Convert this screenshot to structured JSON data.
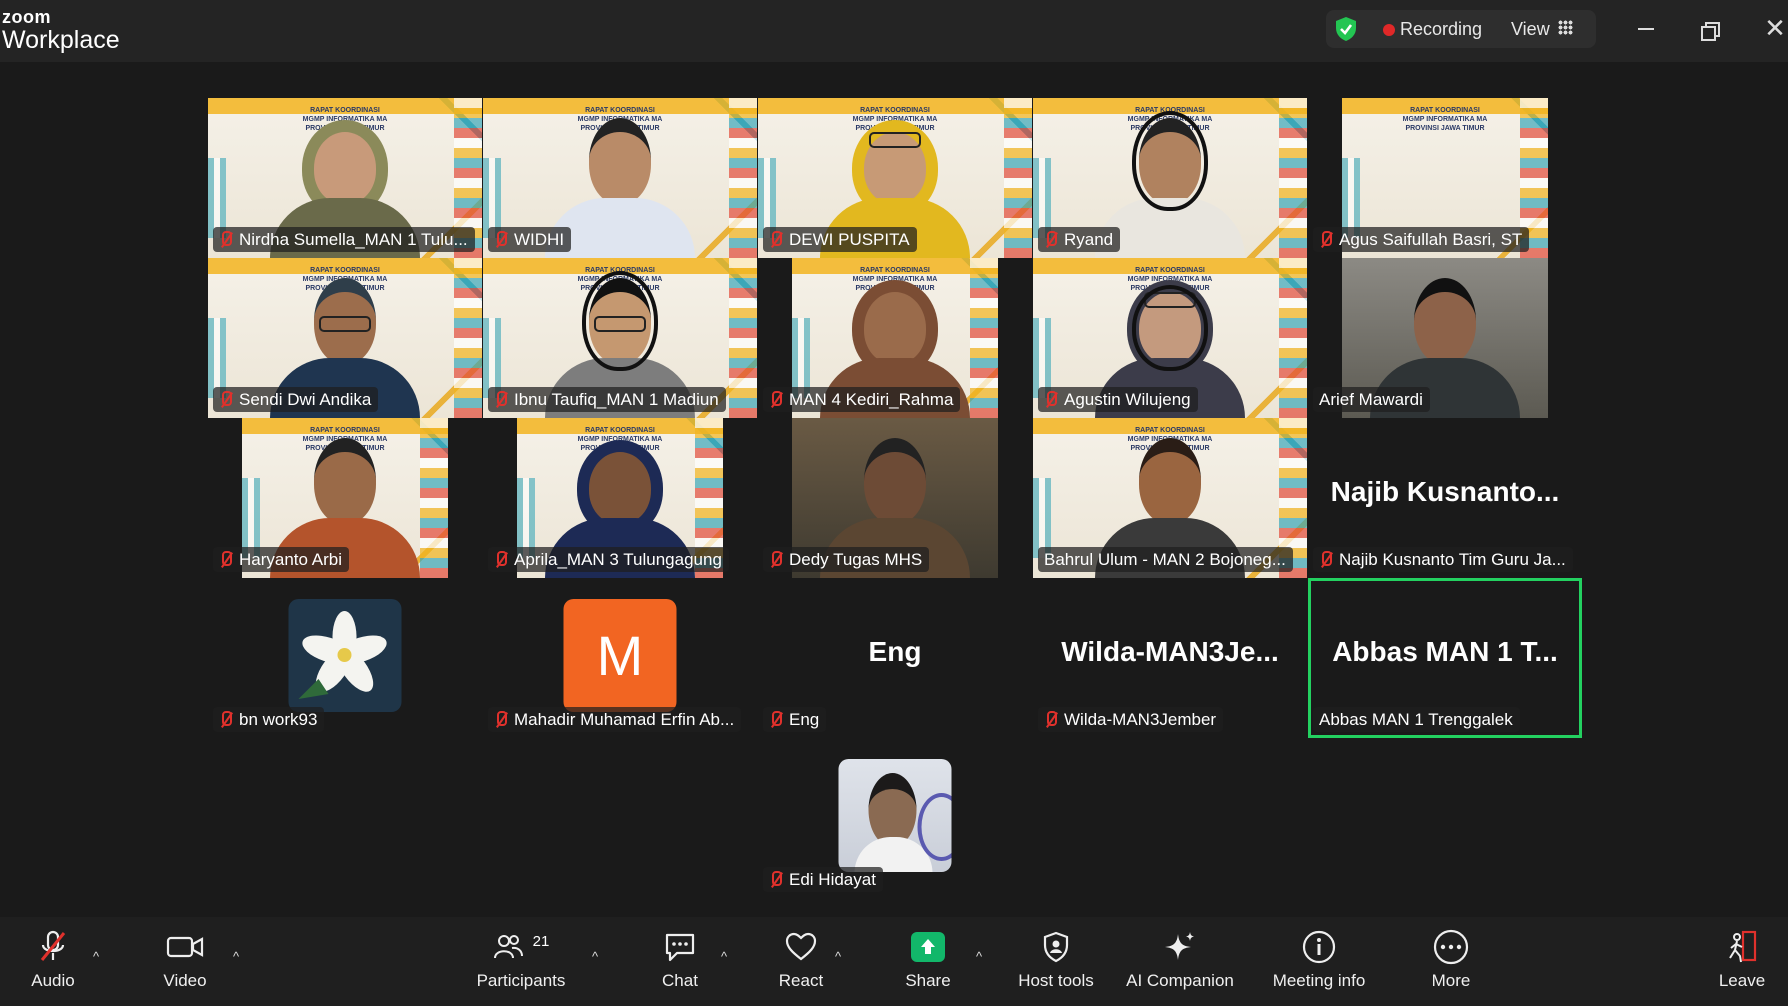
{
  "titlebar": {
    "brand_small": "zoom",
    "brand_large": "Workplace",
    "recording_label": "Recording",
    "view_label": "View"
  },
  "participants": [
    {
      "name": "Nirdha Sumella_MAN 1 Tulu...",
      "muted": true
    },
    {
      "name": "WIDHI",
      "muted": true
    },
    {
      "name": "DEWI PUSPITA",
      "muted": true
    },
    {
      "name": "Ryand",
      "muted": true
    },
    {
      "name": "Agus Saifullah Basri, ST",
      "muted": true
    },
    {
      "name": "Sendi Dwi Andika",
      "muted": true
    },
    {
      "name": "Ibnu Taufiq_MAN 1 Madiun",
      "muted": true
    },
    {
      "name": "MAN 4 Kediri_Rahma",
      "muted": true
    },
    {
      "name": "Agustin Wilujeng",
      "muted": true
    },
    {
      "name": "Arief Mawardi",
      "muted": false
    },
    {
      "name": "Haryanto Arbi",
      "muted": true
    },
    {
      "name": "Aprila_MAN 3 Tulungagung",
      "muted": true
    },
    {
      "name": "Dedy Tugas MHS",
      "muted": true
    },
    {
      "name": "Bahrul Ulum - MAN 2 Bojoneg...",
      "muted": false
    },
    {
      "name": "Najib Kusnanto Tim Guru Ja...",
      "muted": true,
      "big_label": "Najib  Kusnanto..."
    },
    {
      "name": "bn work93",
      "muted": true
    },
    {
      "name": "Mahadir Muhamad Erfin Ab...",
      "muted": true,
      "avatar_letter": "M"
    },
    {
      "name": "Eng",
      "muted": true,
      "big_label": "Eng"
    },
    {
      "name": "Wilda-MAN3Jember",
      "muted": true,
      "big_label": "Wilda-MAN3Je..."
    },
    {
      "name": "Abbas MAN 1 Trenggalek",
      "muted": false,
      "big_label": "Abbas MAN 1 T...",
      "active_speaker": true
    },
    {
      "name": "Edi Hidayat",
      "muted": true
    }
  ],
  "banner_text": "RAPAT KOORDINASI\nMGMP INFORMATIKA MA\nPROVINSI JAWA TIMUR",
  "toolbar": {
    "audio": "Audio",
    "video": "Video",
    "participants": "Participants",
    "participants_count": "21",
    "chat": "Chat",
    "react": "React",
    "share": "Share",
    "host_tools": "Host tools",
    "ai_companion": "AI Companion",
    "meeting_info": "Meeting info",
    "more": "More",
    "leave": "Leave"
  },
  "colors": {
    "active_speaker_border": "#23d160",
    "share_button": "#12b76a",
    "mute_red": "#e0312c",
    "avatar_orange": "#f26522"
  }
}
